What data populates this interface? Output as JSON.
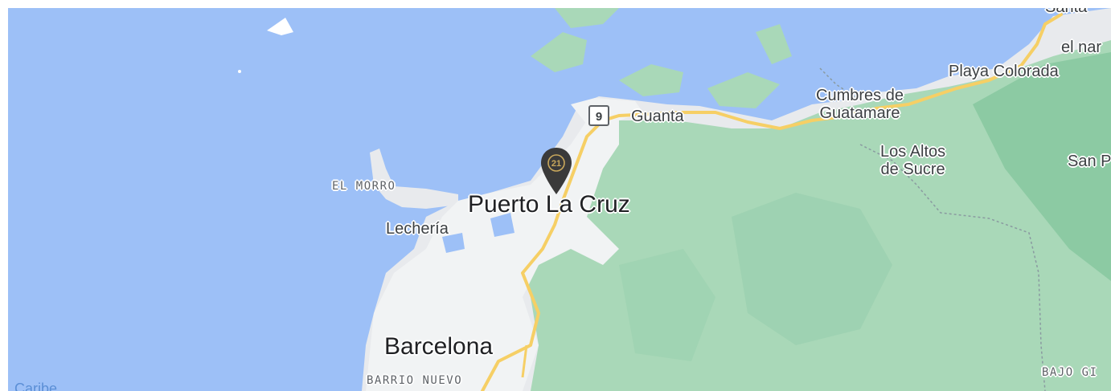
{
  "map": {
    "colors": {
      "water": "#9dc0f7",
      "land": "#e8eaed",
      "forest": "#a9d8b8",
      "forest_dark": "#8ccaa3",
      "road": "#f6cf65",
      "urban": "#f1f3f4",
      "pin": "#3a3a3a",
      "pin_logo": "#c9a85c"
    },
    "labels": {
      "puerto_la_cruz": "Puerto La Cruz",
      "barcelona": "Barcelona",
      "lecheria": "Lechería",
      "el_morro": "EL MORRO",
      "barrio_nuevo": "BARRIO NUEVO",
      "guanta": "Guanta",
      "cumbres_line1": "Cumbres de",
      "cumbres_line2": "Guatamare",
      "los_altos_line1": "Los Altos",
      "los_altos_line2": "de Sucre",
      "playa_colorada": "Playa Colorada",
      "el_nar": "el nar",
      "san_p": "San P",
      "bajo_g": "BAJO GI",
      "caribe": "Caribe",
      "top_right_cut": "Santa"
    },
    "route_shield": "9",
    "marker": {
      "icon": "century21-pin-icon",
      "logo_text": "21"
    }
  }
}
